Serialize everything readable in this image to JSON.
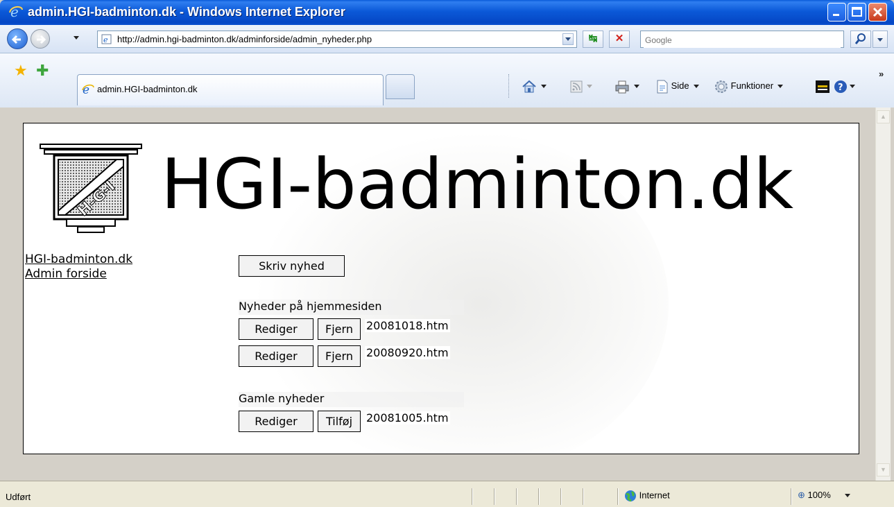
{
  "window": {
    "title": "admin.HGI-badminton.dk - Windows Internet Explorer"
  },
  "address": {
    "url": "http://admin.hgi-badminton.dk/adminforside/admin_nyheder.php"
  },
  "search": {
    "placeholder": "Google"
  },
  "tab": {
    "label": "admin.HGI-badminton.dk"
  },
  "toolbar": {
    "side_label": "Side",
    "funktioner_label": "Funktioner"
  },
  "page": {
    "site_title": "HGI-badminton.dk",
    "nav_links": [
      "HGI-badminton.dk",
      "Admin forside"
    ],
    "write_news_button": "Skriv nyhed",
    "current_news": {
      "heading": "Nyheder på hjemmesiden",
      "items": [
        {
          "edit": "Rediger",
          "action": "Fjern",
          "file": "20081018.htm"
        },
        {
          "edit": "Rediger",
          "action": "Fjern",
          "file": "20080920.htm"
        }
      ]
    },
    "old_news": {
      "heading": "Gamle nyheder",
      "items": [
        {
          "edit": "Rediger",
          "action": "Tilføj",
          "file": "20081005.htm"
        }
      ]
    }
  },
  "status": {
    "text": "Udført",
    "zone": "Internet",
    "zoom": "100%"
  },
  "icons": {
    "browser": "ie-icon",
    "back": "back-arrow-icon",
    "forward": "forward-arrow-icon",
    "refresh": "refresh-icon",
    "stop": "stop-icon",
    "search": "magnifier-icon",
    "favorites": "star-icon",
    "add_favorite": "add-favorite-icon",
    "home": "home-icon",
    "feeds": "rss-icon",
    "print": "printer-icon",
    "page": "page-icon",
    "tools": "gear-icon",
    "help": "help-icon",
    "globe": "globe-icon",
    "zoom": "zoom-icon"
  },
  "colors": {
    "titlebar": "#0b59d8",
    "chrome": "#d4d0c8",
    "page_border": "#000000"
  }
}
